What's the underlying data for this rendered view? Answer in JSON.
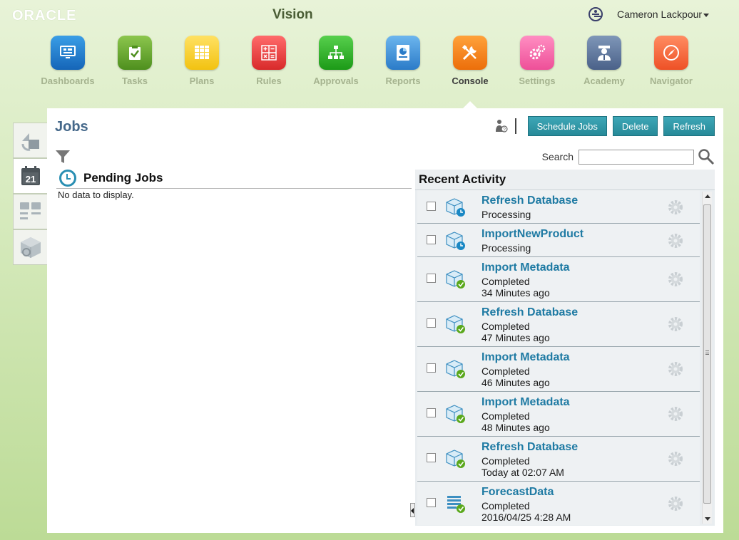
{
  "header": {
    "brand": "ORACLE",
    "app_title": "Vision",
    "user_name": "Cameron Lackpour"
  },
  "nav": [
    {
      "label": "Dashboards",
      "icon": "dashboards-icon"
    },
    {
      "label": "Tasks",
      "icon": "tasks-icon"
    },
    {
      "label": "Plans",
      "icon": "plans-icon"
    },
    {
      "label": "Rules",
      "icon": "rules-icon"
    },
    {
      "label": "Approvals",
      "icon": "approvals-icon"
    },
    {
      "label": "Reports",
      "icon": "reports-icon"
    },
    {
      "label": "Console",
      "icon": "console-icon",
      "active": true
    },
    {
      "label": "Settings",
      "icon": "settings-icon"
    },
    {
      "label": "Academy",
      "icon": "academy-icon"
    },
    {
      "label": "Navigator",
      "icon": "navigator-icon"
    }
  ],
  "side_tabs": [
    {
      "icon": "shapes-icon"
    },
    {
      "icon": "calendar-icon",
      "text": "21",
      "active": true
    },
    {
      "icon": "tiles-icon"
    },
    {
      "icon": "cube-target-icon"
    }
  ],
  "page": {
    "title": "Jobs",
    "buttons": {
      "schedule": "Schedule Jobs",
      "delete": "Delete",
      "refresh": "Refresh"
    },
    "search_label": "Search",
    "search_value": ""
  },
  "pending": {
    "title": "Pending Jobs",
    "empty_text": "No data to display."
  },
  "recent": {
    "title": "Recent Activity",
    "jobs": [
      {
        "title": "Refresh Database",
        "status": "Processing",
        "time": "",
        "icon": "cube-processing-icon"
      },
      {
        "title": "ImportNewProduct",
        "status": "Processing",
        "time": "",
        "icon": "cube-processing-icon"
      },
      {
        "title": "Import Metadata",
        "status": "Completed",
        "time": "34 Minutes ago",
        "icon": "cube-completed-icon"
      },
      {
        "title": "Refresh Database",
        "status": "Completed",
        "time": "47 Minutes ago",
        "icon": "cube-completed-icon"
      },
      {
        "title": "Import Metadata",
        "status": "Completed",
        "time": "46 Minutes ago",
        "icon": "cube-completed-icon"
      },
      {
        "title": "Import Metadata",
        "status": "Completed",
        "time": "48 Minutes ago",
        "icon": "cube-completed-icon"
      },
      {
        "title": "Refresh Database",
        "status": "Completed",
        "time": "Today at 02:07 AM",
        "icon": "cube-completed-icon"
      },
      {
        "title": "ForecastData",
        "status": "Completed",
        "time": "2016/04/25 4:28 AM",
        "icon": "list-completed-icon"
      }
    ]
  },
  "colors": {
    "accent": "#2a97a8",
    "link": "#1e7aa3",
    "title": "#45688a"
  }
}
